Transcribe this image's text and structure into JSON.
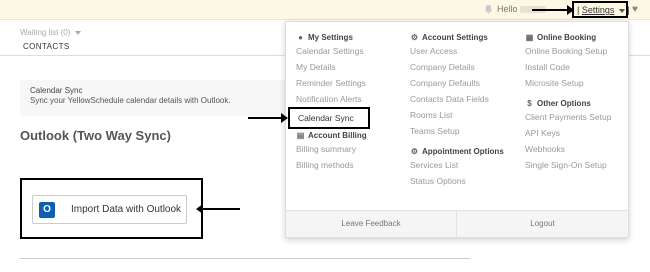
{
  "topbar": {
    "hello": "Hello",
    "settings": "Settings",
    "separator": "|"
  },
  "nav": {
    "waiting_list": "Waiting list (0)",
    "contacts": "CONTACTS"
  },
  "sync": {
    "title": "Calendar Sync",
    "description": "Sync your YellowSchedule calendar details with Outlook."
  },
  "main": {
    "heading": "Outlook (Two Way Sync)",
    "import_button": "Import Data with Outlook"
  },
  "dropdown": {
    "my_settings": {
      "header": "My Settings",
      "items": [
        "Calendar Settings",
        "My Details",
        "Reminder Settings",
        "Notification Alerts",
        "Calendar Sync"
      ]
    },
    "account_billing": {
      "header": "Account Billing",
      "items": [
        "Billing summary",
        "Billing methods"
      ]
    },
    "account_settings": {
      "header": "Account Settings",
      "items": [
        "User Access",
        "Company Details",
        "Company Defaults",
        "Contacts Data Fields",
        "Rooms List",
        "Teams Setup"
      ]
    },
    "appointment_options": {
      "header": "Appointment Options",
      "items": [
        "Services List",
        "Status Options"
      ]
    },
    "online_booking": {
      "header": "Online Booking",
      "items": [
        "Online Booking Setup",
        "Install Code",
        "Microsite Setup"
      ]
    },
    "other_options": {
      "header": "Other Options",
      "items": [
        "Client Payments Setup",
        "API Keys",
        "Webhooks",
        "Single Sign-On Setup"
      ]
    },
    "footer": {
      "leave_feedback": "Leave Feedback",
      "logout": "Logout"
    }
  },
  "icons": {
    "outlook": "O"
  }
}
